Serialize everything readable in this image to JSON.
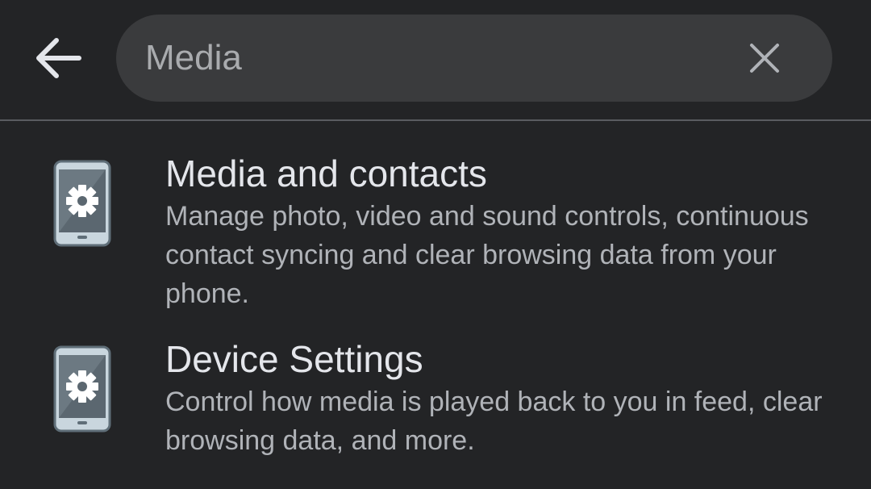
{
  "header": {
    "back_icon": "arrow-left-icon",
    "search": {
      "value": "Media",
      "clear_icon": "close-icon"
    }
  },
  "results": [
    {
      "icon": "phone-settings-icon",
      "title": "Media and contacts",
      "description": "Manage photo, video and sound controls, continuous contact syncing and clear browsing data from your phone."
    },
    {
      "icon": "phone-settings-icon",
      "title": "Device Settings",
      "description": "Control how media is played back to you in feed, clear browsing data, and more."
    }
  ],
  "colors": {
    "background": "#232426",
    "search_pill": "#3a3b3d",
    "title_text": "#e4e6eb",
    "secondary_text": "#b0b3b8",
    "divider": "#5a5c60"
  }
}
